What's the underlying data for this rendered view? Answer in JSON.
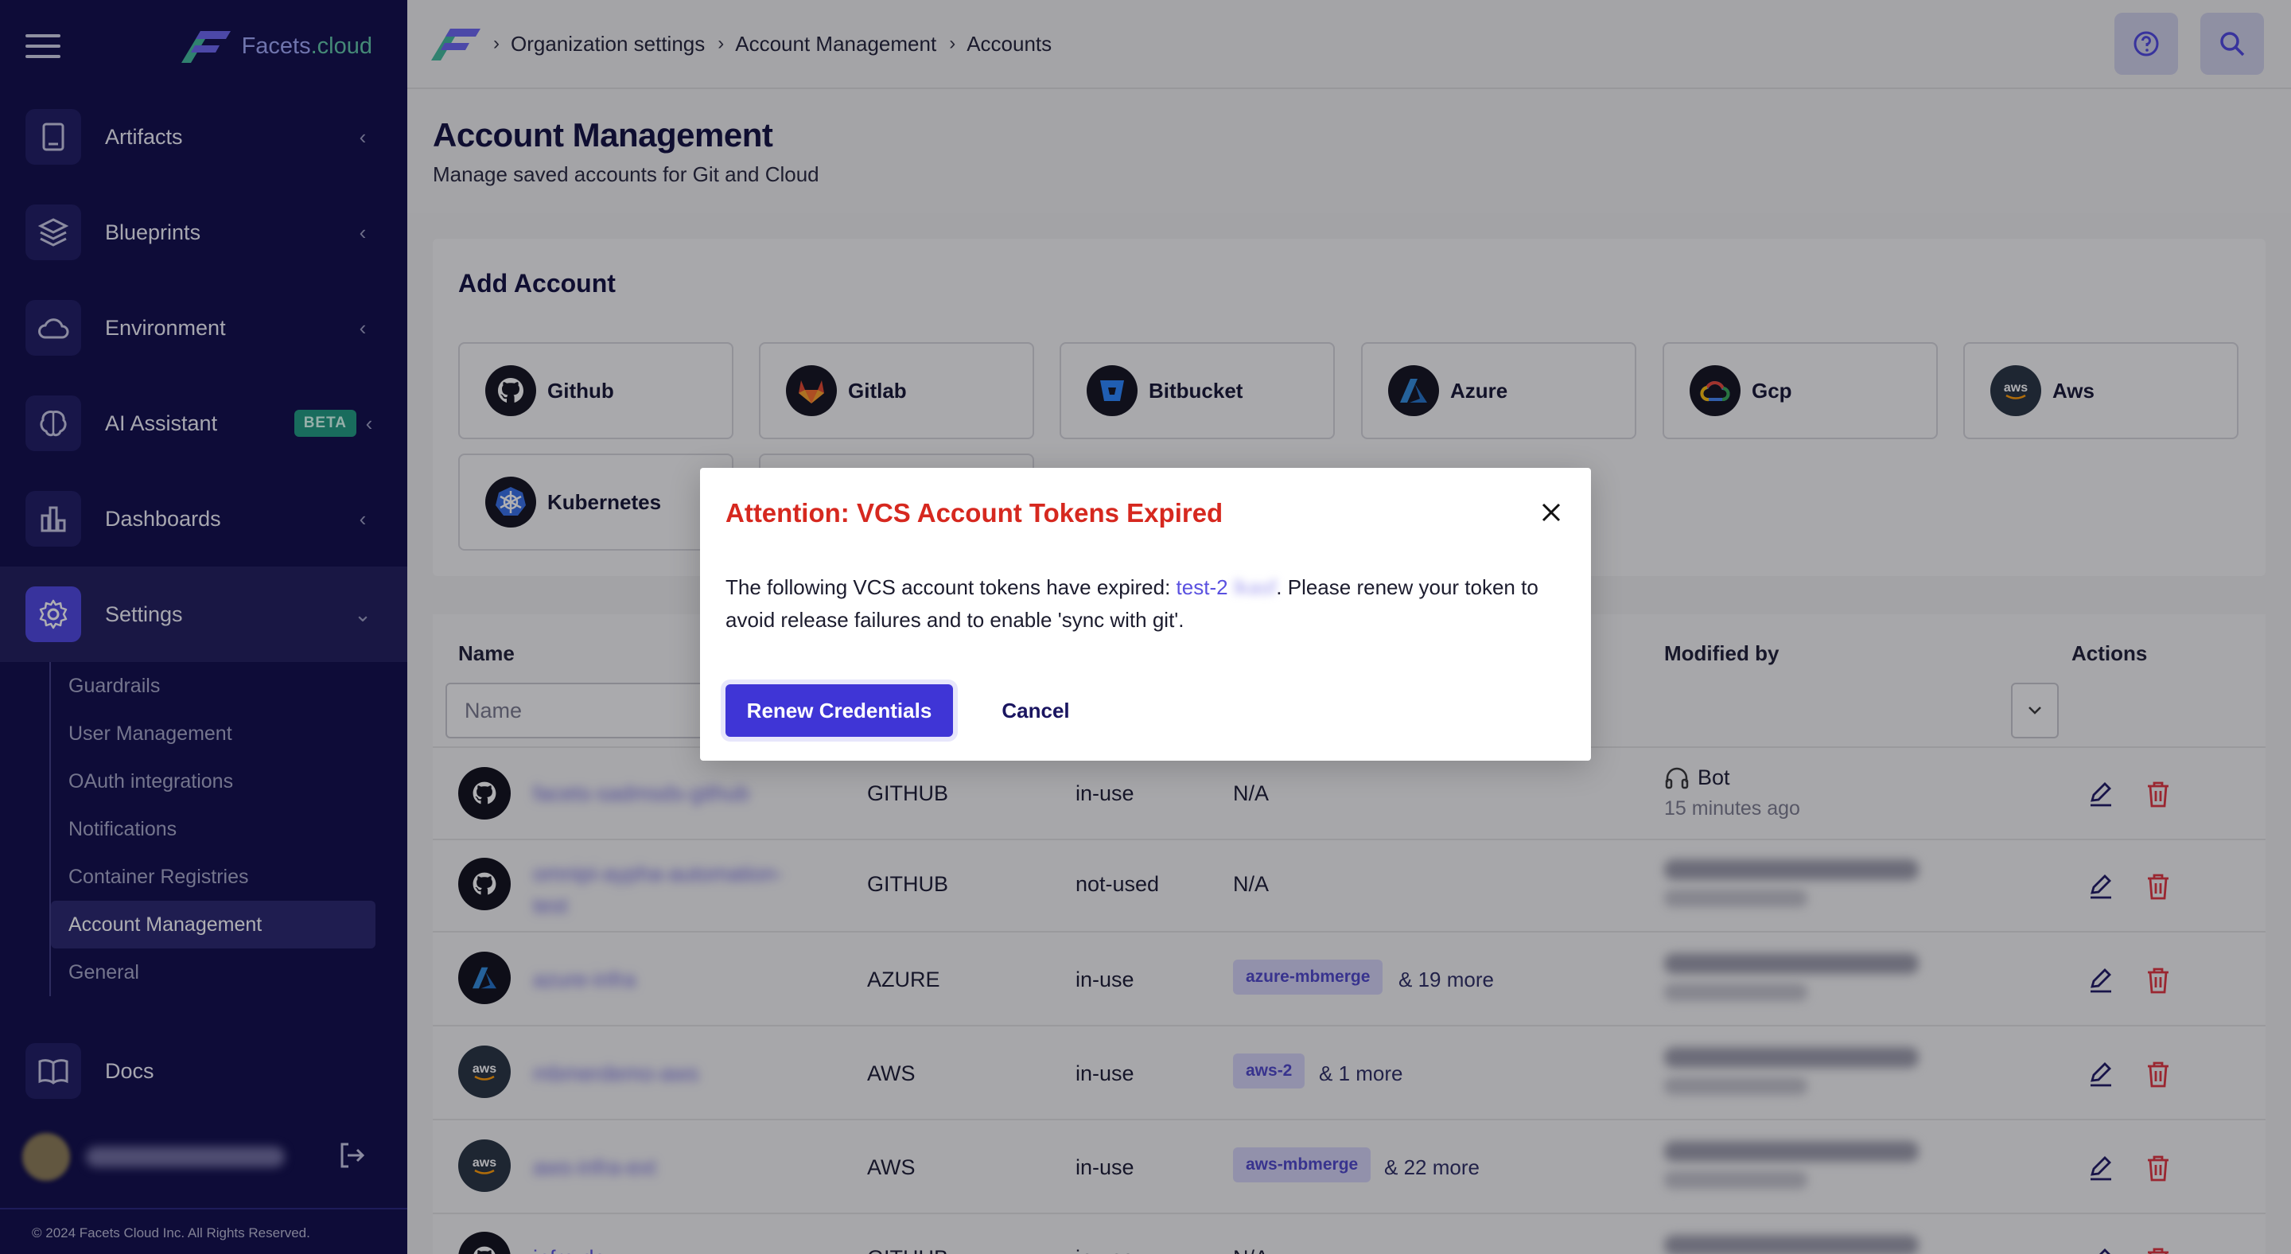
{
  "brand": {
    "name_prefix": "Facets",
    "name_suffix": ".cloud"
  },
  "sidebar": {
    "items": [
      {
        "label": "Artifacts",
        "icon": "artifacts-icon"
      },
      {
        "label": "Blueprints",
        "icon": "layers-icon"
      },
      {
        "label": "Environment",
        "icon": "cloud-icon"
      },
      {
        "label": "AI Assistant",
        "icon": "ai-brain-icon",
        "badge": "BETA"
      },
      {
        "label": "Dashboards",
        "icon": "bar-chart-icon"
      },
      {
        "label": "Settings",
        "icon": "gear-icon"
      },
      {
        "label": "Docs",
        "icon": "book-icon"
      }
    ],
    "settings_sub": [
      "Guardrails",
      "User Management",
      "OAuth integrations",
      "Notifications",
      "Container Registries",
      "Account Management",
      "General"
    ],
    "footer": "© 2024 Facets Cloud Inc. All Rights Reserved."
  },
  "breadcrumb": [
    "Organization settings",
    "Account Management",
    "Accounts"
  ],
  "page": {
    "title": "Account Management",
    "subtitle": "Manage saved accounts for Git and Cloud"
  },
  "add_account": {
    "title": "Add Account",
    "providers": [
      "Github",
      "Gitlab",
      "Bitbucket",
      "Azure",
      "Gcp",
      "Aws",
      "Kubernetes"
    ]
  },
  "table": {
    "headers": {
      "name": "Name",
      "modified_by": "Modified by",
      "actions": "Actions"
    },
    "name_placeholder": "Name",
    "rows": [
      {
        "name": "facets-sadmsds-github",
        "type": "GITHUB",
        "status": "in-use",
        "projects": "N/A",
        "chip": "",
        "more": "",
        "modified_by": "Bot",
        "modified_time": "15 minutes ago"
      },
      {
        "name": "omnipi-aypha-automation-test",
        "type": "GITHUB",
        "status": "not-used",
        "projects": "N/A",
        "chip": "",
        "more": "",
        "modified_by": "",
        "modified_time": ""
      },
      {
        "name": "azure-infra",
        "type": "AZURE",
        "status": "in-use",
        "projects": "",
        "chip": "azure-mbmerge",
        "more": "& 19 more",
        "modified_by": "",
        "modified_time": ""
      },
      {
        "name": "mbmerdemo-aws",
        "type": "AWS",
        "status": "in-use",
        "projects": "",
        "chip": "aws-2",
        "more": "& 1 more",
        "modified_by": "",
        "modified_time": ""
      },
      {
        "name": "aws-infra-ext",
        "type": "AWS",
        "status": "in-use",
        "projects": "",
        "chip": "aws-mbmerge",
        "more": "& 22 more",
        "modified_by": "",
        "modified_time": ""
      },
      {
        "name": "infra-dev",
        "type": "GITHUB",
        "status": "in-use",
        "projects": "N/A",
        "chip": "",
        "more": "",
        "modified_by": "",
        "modified_time": ""
      }
    ]
  },
  "modal": {
    "title": "Attention: VCS Account Tokens Expired",
    "body_prefix": "The following VCS account tokens have expired: ",
    "token_name": "test-2",
    "token_hidden": "lkasf",
    "body_suffix": ". Please renew your token to avoid release failures and to enable 'sync with git'.",
    "primary_button": "Renew Credentials",
    "cancel_button": "Cancel"
  },
  "colors": {
    "sidebar_bg": "#0b0846",
    "accent": "#3f35d6",
    "danger": "#d6281f",
    "chip_bg": "#d4d2f5"
  }
}
